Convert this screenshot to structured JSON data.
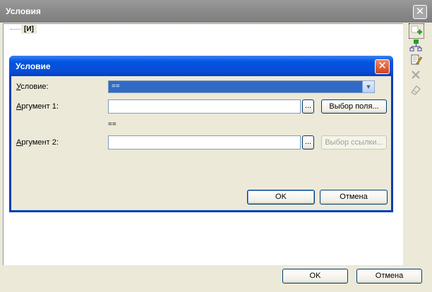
{
  "outer": {
    "title": "Условия",
    "close_glyph": "✕",
    "tree_root": "[И]",
    "ok": "OK",
    "cancel": "Отмена",
    "toolbar": [
      "add-condition-icon",
      "add-group-icon",
      "edit-icon",
      "delete-icon",
      "clear-icon"
    ]
  },
  "dialog": {
    "title": "Условие",
    "close_glyph": "✕",
    "condition_label_u": "У",
    "condition_label_rest": "словие:",
    "condition_value": "==",
    "arg1_label_u": "А",
    "arg1_label_rest": "ргумент 1:",
    "arg1_value": "",
    "browse_dots": "...",
    "field_button": "Выбор поля...",
    "operator_text": "==",
    "arg2_label_u": "А",
    "arg2_label_rest": "ргумент 2:",
    "arg2_value": "",
    "link_button": "Выбор ссылки...",
    "ok": "OK",
    "cancel": "Отмена"
  }
}
